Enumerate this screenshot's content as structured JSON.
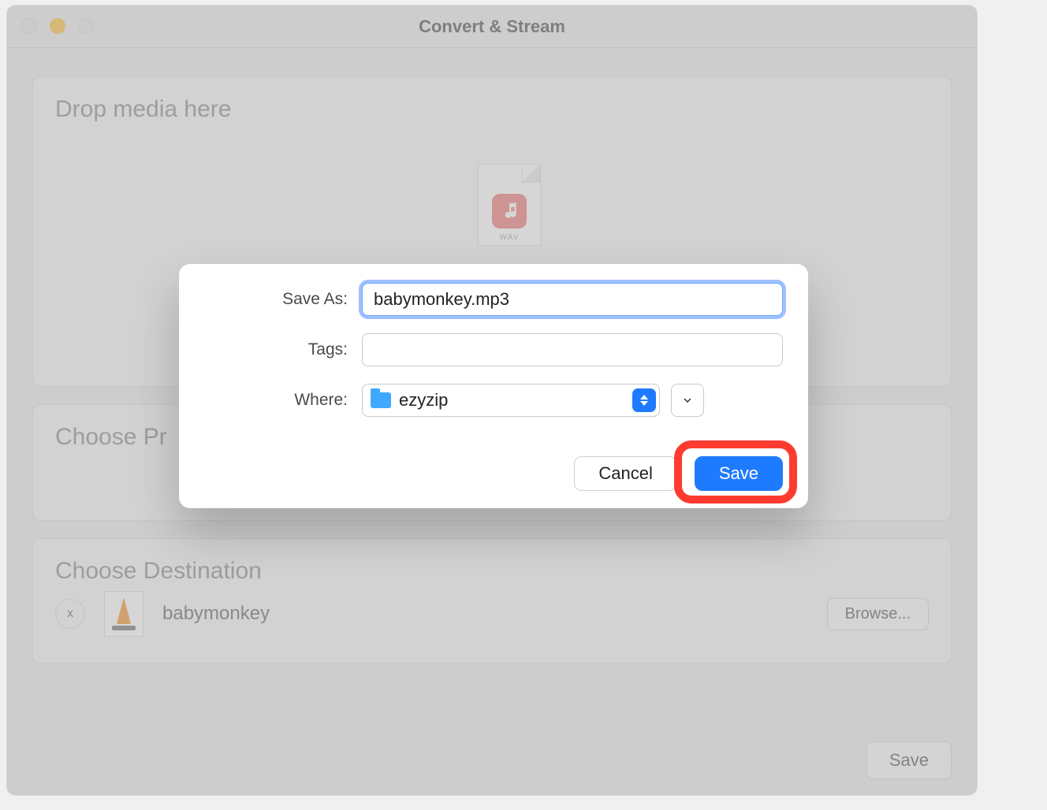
{
  "window": {
    "title": "Convert & Stream"
  },
  "panels": {
    "drop_title": "Drop media here",
    "drop_file_ext": "WAV",
    "profile_title": "Choose Pr",
    "dest_title": "Choose Destination",
    "dest_file_name": "babymonkey",
    "browse_label": "Browse...",
    "footer_save_label": "Save",
    "close_icon_label": "x"
  },
  "dialog": {
    "save_as_label": "Save As:",
    "save_as_value": "babymonkey.mp3",
    "tags_label": "Tags:",
    "tags_value": "",
    "where_label": "Where:",
    "where_value": "ezyzip",
    "cancel_label": "Cancel",
    "save_label": "Save"
  }
}
